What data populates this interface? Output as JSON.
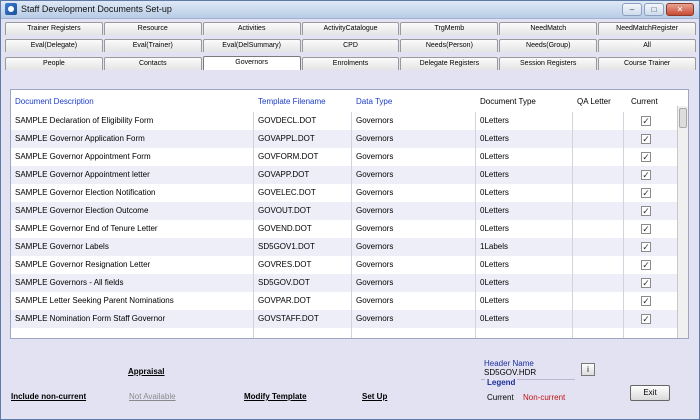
{
  "window": {
    "title": "Staff Development Documents Set-up",
    "min": "–",
    "max": "□",
    "close": "✕"
  },
  "tabs": {
    "row1": [
      "Trainer Registers",
      "Resource",
      "Activities",
      "ActivityCatalogue",
      "TrgMemb",
      "NeedMatch",
      "NeedMatchRegister"
    ],
    "row2": [
      "Eval(Delegate)",
      "Eval(Trainer)",
      "Eval(DelSummary)",
      "CPD",
      "Needs(Person)",
      "Needs(Group)",
      "All"
    ],
    "row3": [
      "People",
      "Contacts",
      "Governors",
      "Enrolments",
      "Delegate Registers",
      "Session Registers",
      "Course Trainer"
    ],
    "active": "Governors"
  },
  "grid": {
    "headers": [
      "Document Description",
      "Template Filename",
      "Data Type",
      "Document Type",
      "QA Letter",
      "Current"
    ],
    "rows": [
      [
        "SAMPLE Declaration of Eligibility Form",
        "GOVDECL.DOT",
        "Governors",
        "0Letters",
        "",
        "✓"
      ],
      [
        "SAMPLE Governor Application Form",
        "GOVAPPL.DOT",
        "Governors",
        "0Letters",
        "",
        "✓"
      ],
      [
        "SAMPLE Governor Appointment Form",
        "GOVFORM.DOT",
        "Governors",
        "0Letters",
        "",
        "✓"
      ],
      [
        "SAMPLE Governor Appointment letter",
        "GOVAPP.DOT",
        "Governors",
        "0Letters",
        "",
        "✓"
      ],
      [
        "SAMPLE Governor Election Notification",
        "GOVELEC.DOT",
        "Governors",
        "0Letters",
        "",
        "✓"
      ],
      [
        "SAMPLE Governor Election Outcome",
        "GOVOUT.DOT",
        "Governors",
        "0Letters",
        "",
        "✓"
      ],
      [
        "SAMPLE Governor End of Tenure Letter",
        "GOVEND.DOT",
        "Governors",
        "0Letters",
        "",
        "✓"
      ],
      [
        "SAMPLE Governor Labels",
        "SD5GOV1.DOT",
        "Governors",
        "1Labels",
        "",
        "✓"
      ],
      [
        "SAMPLE Governor Resignation Letter",
        "GOVRES.DOT",
        "Governors",
        "0Letters",
        "",
        "✓"
      ],
      [
        "SAMPLE Governors - All fields",
        "SD5GOV.DOT",
        "Governors",
        "0Letters",
        "",
        "✓"
      ],
      [
        "SAMPLE Letter Seeking Parent Nominations",
        "GOVPAR.DOT",
        "Governors",
        "0Letters",
        "",
        "✓"
      ],
      [
        "SAMPLE Nomination Form Staff Governor",
        "GOVSTAFF.DOT",
        "Governors",
        "0Letters",
        "",
        "✓"
      ],
      [
        "",
        "",
        "",
        "",
        "",
        ""
      ]
    ]
  },
  "links": {
    "appraisal": "Appraisal",
    "include_non_current": "Include non-current",
    "not_available": "Not Available",
    "modify_template": "Modify Template",
    "set_up": "Set Up"
  },
  "header_name": {
    "label": "Header Name",
    "value": "SD5GOV.HDR",
    "info": "i"
  },
  "legend": {
    "title": "Legend",
    "current": "Current",
    "non_current": "Non-current",
    "non_current_color": "#c31414"
  },
  "exit_label": "Exit",
  "colors": {
    "window_bg": "#e3e2f2",
    "header_blue": "#1a3ccc",
    "alt_row": "#eeeef8"
  }
}
